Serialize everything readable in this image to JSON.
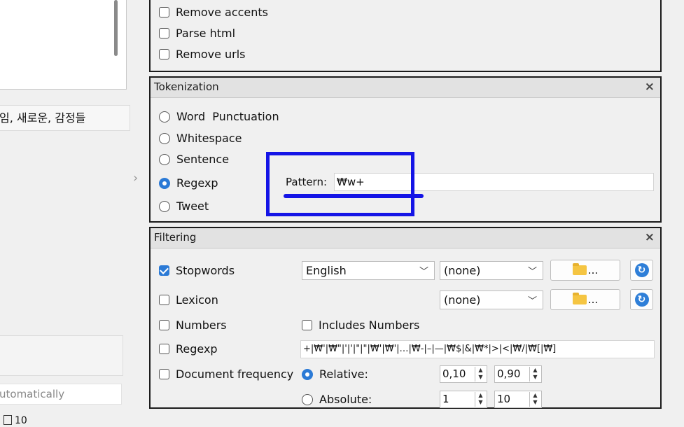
{
  "left_pane": {
    "words_text": "임, 새로운, 감정들",
    "auto_text": "utomatically",
    "status_value": "10",
    "arrow_glyph": "›"
  },
  "preprocess": {
    "options": [
      {
        "label": "Remove accents",
        "checked": false
      },
      {
        "label": "Parse html",
        "checked": false
      },
      {
        "label": "Remove urls",
        "checked": false
      }
    ]
  },
  "tokenization": {
    "title": "Tokenization",
    "close_glyph": "×",
    "options": [
      {
        "label": "Word  Punctuation",
        "selected": false
      },
      {
        "label": "Whitespace",
        "selected": false
      },
      {
        "label": "Sentence",
        "selected": false
      },
      {
        "label": "Regexp",
        "selected": true
      },
      {
        "label": "Tweet",
        "selected": false
      }
    ],
    "pattern_label": "Pattern:",
    "pattern_value": "₩w+"
  },
  "filtering": {
    "title": "Filtering",
    "close_glyph": "×",
    "stopwords": {
      "label": "Stopwords",
      "checked": true,
      "language": "English",
      "file": "(none)",
      "browse_label": "..."
    },
    "lexicon": {
      "label": "Lexicon",
      "checked": false,
      "file": "(none)",
      "browse_label": "..."
    },
    "numbers": {
      "label": "Numbers",
      "checked": false
    },
    "includes_numbers": {
      "label": "Includes Numbers",
      "checked": false
    },
    "regexp": {
      "label": "Regexp",
      "checked": false,
      "value": "+|₩'|₩\"|'|'|\"|\"|₩'|₩'|…|₩-|–|—|₩$|&|₩*|>|<|₩/|₩[|₩]"
    },
    "doc_freq": {
      "label": "Document frequency",
      "checked": false,
      "relative": {
        "label": "Relative:",
        "selected": true,
        "min": "0,10",
        "max": "0,90"
      },
      "absolute": {
        "label": "Absolute:",
        "selected": false,
        "min": "1",
        "max": "10"
      }
    }
  },
  "colors": {
    "accent": "#2b7ad6",
    "annotation": "#1414e6"
  }
}
